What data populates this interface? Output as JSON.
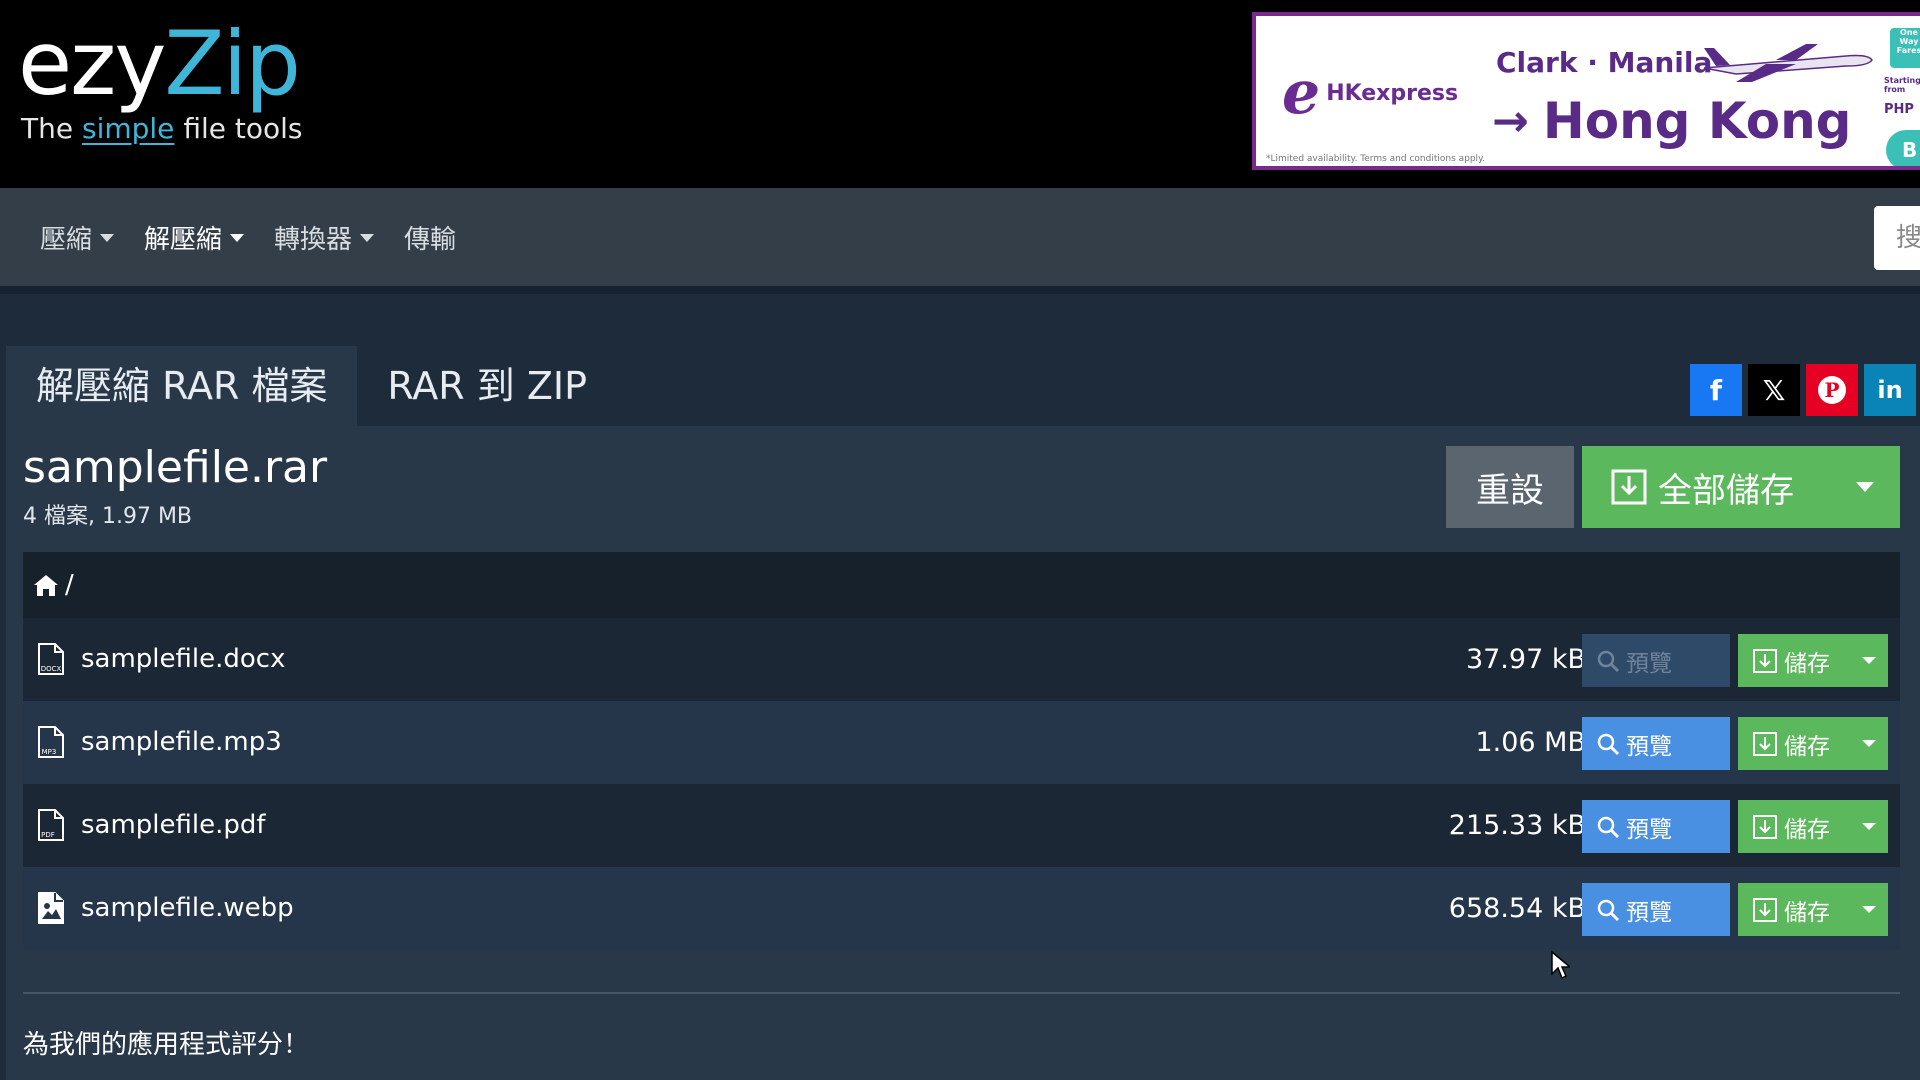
{
  "header": {
    "logo": {
      "part1": "ezy",
      "part2": "Zip",
      "tagline_before": "The",
      "tagline_highlight": "simple",
      "tagline_after": "file tools"
    },
    "ad": {
      "brand_mark": "e",
      "brand_name": "HKexpress",
      "route": "Clark · Manila",
      "arrow": "→",
      "destination": "Hong Kong",
      "fine_print": "*Limited availability. Terms and conditions apply.",
      "badge_top": "One Way Fares",
      "badge_mid": "Starting from",
      "badge_currency": "PHP",
      "badge_button": "B"
    }
  },
  "nav": {
    "items": [
      {
        "label": "壓縮",
        "has_dropdown": true
      },
      {
        "label": "解壓縮",
        "has_dropdown": true
      },
      {
        "label": "轉換器",
        "has_dropdown": true
      },
      {
        "label": "傳輸",
        "has_dropdown": false
      }
    ],
    "search_placeholder": "搜"
  },
  "tabs": [
    {
      "label": "解壓縮 RAR 檔案",
      "active": true
    },
    {
      "label": "RAR 到 ZIP",
      "active": false
    }
  ],
  "social": {
    "facebook": "f",
    "x": "𝕏",
    "pinterest": "P",
    "linkedin": "in"
  },
  "archive": {
    "filename": "samplefile.rar",
    "meta": "4 檔案, 1.97 MB",
    "reset_label": "重設",
    "save_all_label": "全部儲存",
    "breadcrumb_path": "/"
  },
  "files": [
    {
      "name": "samplefile.docx",
      "size": "37.97 kB",
      "icon": "docx-file-icon",
      "icon_tag": "DOCX",
      "preview_enabled": false
    },
    {
      "name": "samplefile.mp3",
      "size": "1.06 MB",
      "icon": "mp3-file-icon",
      "icon_tag": "MP3",
      "preview_enabled": true
    },
    {
      "name": "samplefile.pdf",
      "size": "215.33 kB",
      "icon": "pdf-file-icon",
      "icon_tag": "PDF",
      "preview_enabled": true
    },
    {
      "name": "samplefile.webp",
      "size": "658.54 kB",
      "icon": "image-file-icon",
      "icon_tag": "",
      "preview_enabled": true
    }
  ],
  "row_actions": {
    "preview_label": "預覽",
    "save_label": "儲存"
  },
  "footer": {
    "rate_text": "為我們的應用程式評分！"
  },
  "colors": {
    "accent_blue": "#4a90e2",
    "save_green": "#5cb85c",
    "logo_cyan": "#3fb6d8",
    "ad_purple": "#6b2c91"
  }
}
